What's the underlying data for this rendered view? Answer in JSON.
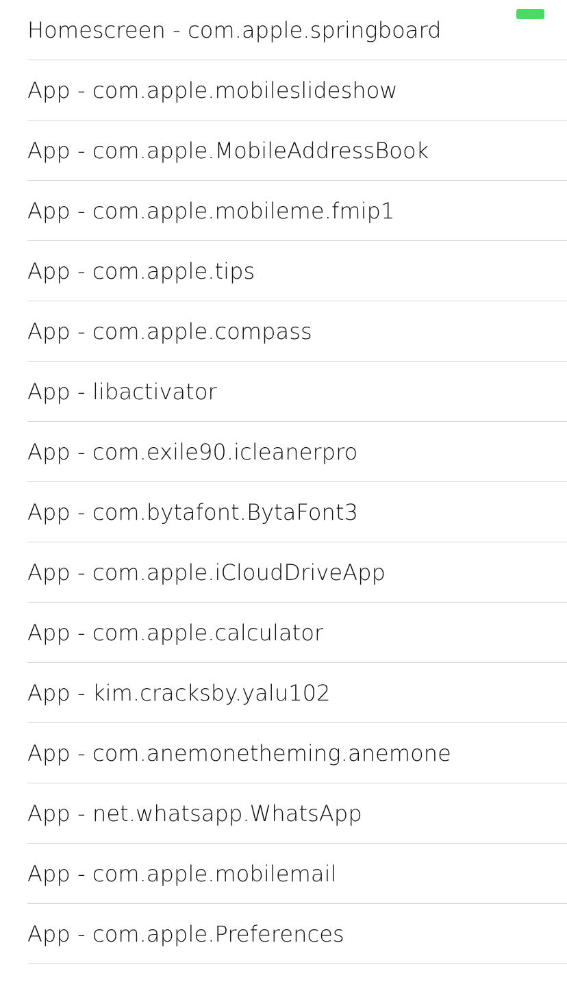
{
  "colors": {
    "accent": "#4cd964",
    "separator": "#d4d4d6",
    "text": "#111111",
    "background": "#ffffff"
  },
  "items": [
    {
      "label": "Homescreen - com.apple.springboard"
    },
    {
      "label": "App - com.apple.mobileslideshow"
    },
    {
      "label": "App - com.apple.MobileAddressBook"
    },
    {
      "label": "App - com.apple.mobileme.fmip1"
    },
    {
      "label": "App - com.apple.tips"
    },
    {
      "label": "App - com.apple.compass"
    },
    {
      "label": "App - libactivator"
    },
    {
      "label": "App - com.exile90.icleanerpro"
    },
    {
      "label": "App - com.bytafont.BytaFont3"
    },
    {
      "label": "App - com.apple.iCloudDriveApp"
    },
    {
      "label": "App - com.apple.calculator"
    },
    {
      "label": "App - kim.cracksby.yalu102"
    },
    {
      "label": "App - com.anemonetheming.anemone"
    },
    {
      "label": "App - net.whatsapp.WhatsApp"
    },
    {
      "label": "App - com.apple.mobilemail"
    },
    {
      "label": "App - com.apple.Preferences"
    }
  ]
}
